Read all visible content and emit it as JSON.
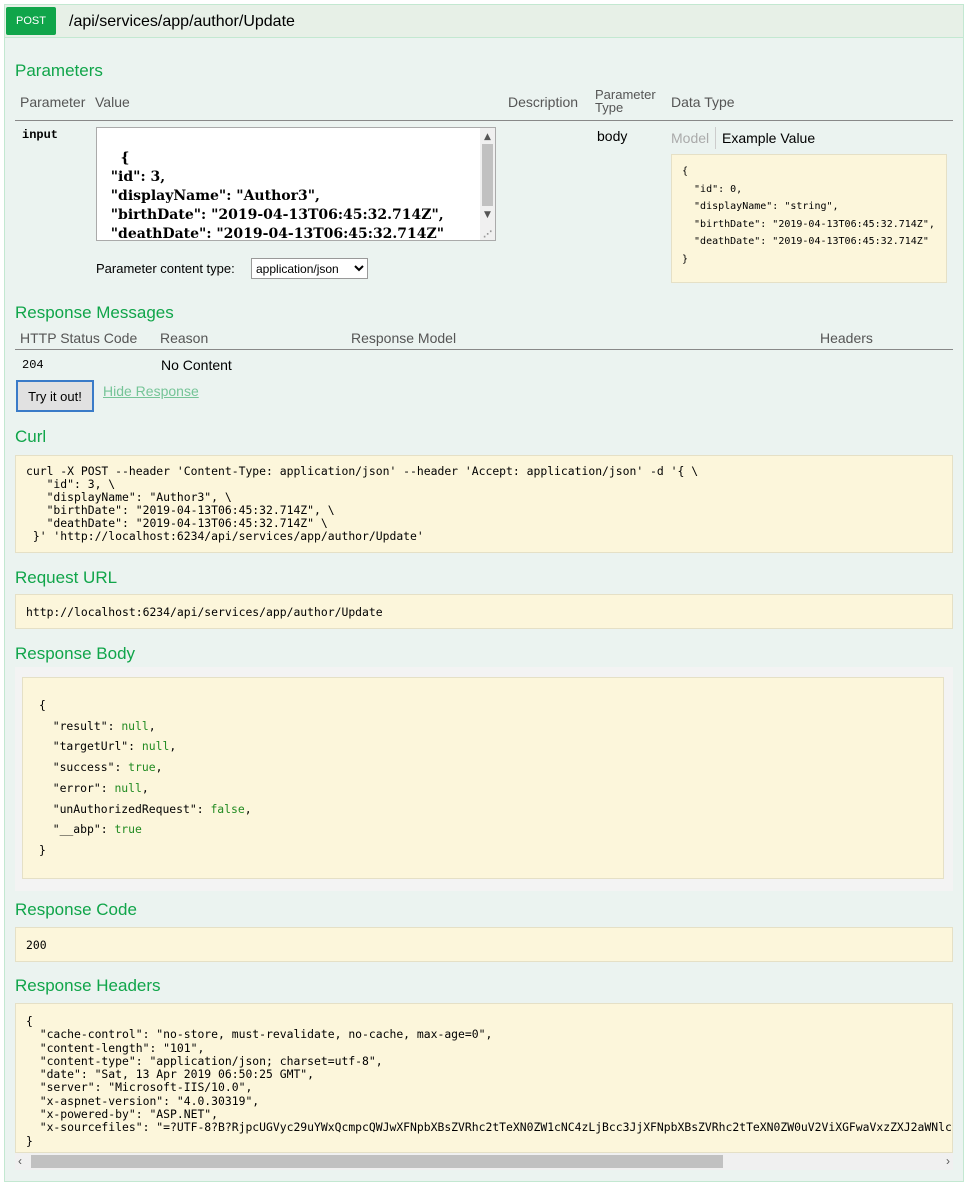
{
  "operation": {
    "method": "POST",
    "path": "/api/services/app/author/Update"
  },
  "parameters": {
    "heading": "Parameters",
    "columns": [
      "Parameter",
      "Value",
      "Description",
      "Parameter Type",
      "Data Type"
    ],
    "param_name": "input",
    "value_text": "{\n  \"id\": 3,\n  \"displayName\": \"Author3\",\n  \"birthDate\": \"2019-04-13T06:45:32.714Z\",\n  \"deathDate\": \"2019-04-13T06:45:32.714Z\"\n}",
    "param_type": "body",
    "content_type_label": "Parameter content type:",
    "content_type_value": "application/json",
    "model_tab": "Model",
    "example_tab": "Example Value",
    "example_value": "{\n  \"id\": 0,\n  \"displayName\": \"string\",\n  \"birthDate\": \"2019-04-13T06:45:32.714Z\",\n  \"deathDate\": \"2019-04-13T06:45:32.714Z\"\n}"
  },
  "response_messages": {
    "heading": "Response Messages",
    "columns": [
      "HTTP Status Code",
      "Reason",
      "Response Model",
      "Headers"
    ],
    "rows": [
      {
        "code": "204",
        "reason": "No Content"
      }
    ]
  },
  "actions": {
    "try_label": "Try it out!",
    "hide_label": "Hide Response"
  },
  "curl": {
    "heading": "Curl",
    "text": "curl -X POST --header 'Content-Type: application/json' --header 'Accept: application/json' -d '{ \\\n   \"id\": 3, \\\n   \"displayName\": \"Author3\", \\\n   \"birthDate\": \"2019-04-13T06:45:32.714Z\", \\\n   \"deathDate\": \"2019-04-13T06:45:32.714Z\" \\\n }' 'http://localhost:6234/api/services/app/author/Update'"
  },
  "request_url": {
    "heading": "Request URL",
    "text": "http://localhost:6234/api/services/app/author/Update"
  },
  "response_body": {
    "heading": "Response Body",
    "lines": [
      {
        "key": "\"result\"",
        "val": "null",
        "comma": ","
      },
      {
        "key": "\"targetUrl\"",
        "val": "null",
        "comma": ","
      },
      {
        "key": "\"success\"",
        "val": "true",
        "comma": ","
      },
      {
        "key": "\"error\"",
        "val": "null",
        "comma": ","
      },
      {
        "key": "\"unAuthorizedRequest\"",
        "val": "false",
        "comma": ","
      },
      {
        "key": "\"__abp\"",
        "val": "true",
        "comma": ""
      }
    ]
  },
  "response_code": {
    "heading": "Response Code",
    "text": "200"
  },
  "response_headers": {
    "heading": "Response Headers",
    "text": "{\n  \"cache-control\": \"no-store, must-revalidate, no-cache, max-age=0\",\n  \"content-length\": \"101\",\n  \"content-type\": \"application/json; charset=utf-8\",\n  \"date\": \"Sat, 13 Apr 2019 06:50:25 GMT\",\n  \"server\": \"Microsoft-IIS/10.0\",\n  \"x-aspnet-version\": \"4.0.30319\",\n  \"x-powered-by\": \"ASP.NET\",\n  \"x-sourcefiles\": \"=?UTF-8?B?RjpcUGVyc29uYWxQcmpcQWJwXFNpbXBsZVRhc2tTeXN0ZW1cNC4zLjBcc3JjXFNpbXBsZVRhc2tTeXN0ZW0uV2ViXGFwaVxzZXJ2aWNlc1xhcHBcYXV0aG9yXFVwZGF0ZQ==?=\"\n}"
  },
  "colors": {
    "accent": "#10a54a",
    "panel": "#ebf3f0",
    "code_bg": "#fcf6db"
  },
  "icons": {
    "scroll_up": "▲",
    "scroll_down": "▼",
    "scroll_left": "‹",
    "scroll_right": "›",
    "resize": "⋰"
  }
}
